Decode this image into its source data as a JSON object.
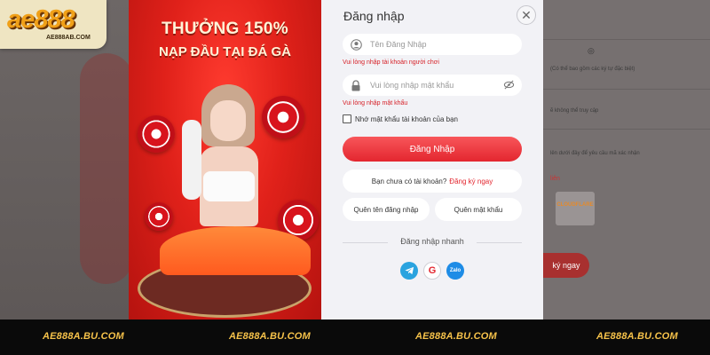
{
  "logo": {
    "mark": "ae888",
    "sub": "AE888AB.COM"
  },
  "promo": {
    "headline": "THƯỞNG 150%",
    "subline": "NẠP ĐẦU TẠI ĐÁ GÀ"
  },
  "login": {
    "title": "Đăng nhập",
    "username": {
      "placeholder": "Tên Đăng Nhập",
      "error": "Vui lòng nhập tài khoản người chơi",
      "icon": "user-icon"
    },
    "password": {
      "placeholder": "Vui lòng nhập mật khẩu",
      "error": "Vui lòng nhập mật khẩu",
      "icon": "lock-icon"
    },
    "remember_label": "Nhớ mật khẩu tài khoản của bạn",
    "submit_label": "Đăng Nhập",
    "no_account_text": "Bạn chưa có tài khoản?",
    "register_link": "Đăng ký ngay",
    "forgot_username": "Quên tên đăng nhập",
    "forgot_password": "Quên mật khẩu",
    "quick_login_label": "Đăng nhập nhanh",
    "social": [
      {
        "name": "telegram",
        "color": "#2aa3df"
      },
      {
        "name": "google",
        "color": "#ffffff"
      },
      {
        "name": "zalo",
        "color": "#1e8ce6",
        "label": "Zalo"
      }
    ],
    "accent_color": "#e3262f"
  },
  "background": {
    "notes": [
      "(Có thể bao gồm các ký tự đặc biệt)",
      "ẽ không thể truy cập",
      "lên dưới đây để yêu cầu mã xác nhận"
    ],
    "link_fragment": "liên",
    "cloudflare": "CLOUDFLARE",
    "button": "ký ngay"
  },
  "footer": {
    "items": [
      "AE888A.BU.COM",
      "AE888A.BU.COM",
      "AE888A.BU.COM",
      "AE888A.BU.COM"
    ]
  }
}
